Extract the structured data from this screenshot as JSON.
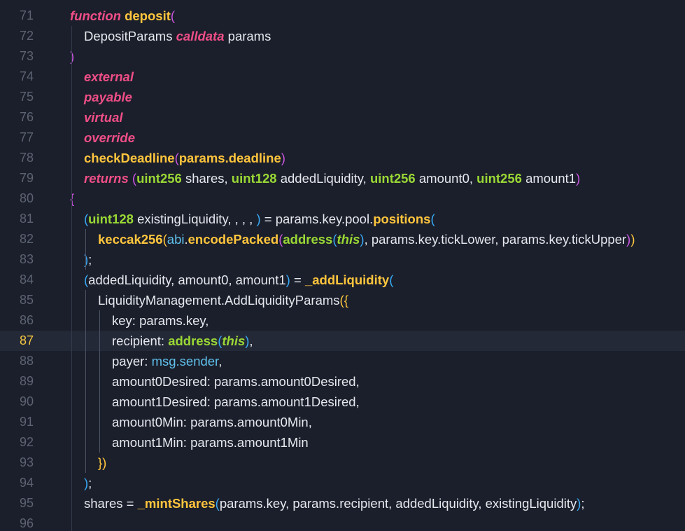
{
  "editor": {
    "current_line": 87,
    "colors": {
      "background": "#1b1f2b",
      "keyword": "#ef4e87",
      "type": "#9ad835",
      "function": "#ffc53d",
      "text": "#e6e8ee",
      "line_number": "#5d6372",
      "active_line_number": "#f3c63f",
      "builtin": "#5fc0ec"
    },
    "lines": [
      {
        "n": "71",
        "indent": 0,
        "tokens": [
          {
            "t": "kw",
            "v": "function"
          },
          {
            "t": "id",
            "v": " "
          },
          {
            "t": "fn",
            "v": "deposit"
          },
          {
            "t": "p1",
            "v": "("
          }
        ]
      },
      {
        "n": "72",
        "indent": 1,
        "tokens": [
          {
            "t": "id",
            "v": "DepositParams "
          },
          {
            "t": "kw",
            "v": "calldata"
          },
          {
            "t": "id",
            "v": " params"
          }
        ]
      },
      {
        "n": "73",
        "indent": 0,
        "tokens": [
          {
            "t": "p1",
            "v": ")"
          }
        ]
      },
      {
        "n": "74",
        "indent": 1,
        "tokens": [
          {
            "t": "kw",
            "v": "external"
          }
        ]
      },
      {
        "n": "75",
        "indent": 1,
        "tokens": [
          {
            "t": "kw",
            "v": "payable"
          }
        ]
      },
      {
        "n": "76",
        "indent": 1,
        "tokens": [
          {
            "t": "kw",
            "v": "virtual"
          }
        ]
      },
      {
        "n": "77",
        "indent": 1,
        "tokens": [
          {
            "t": "kw",
            "v": "override"
          }
        ]
      },
      {
        "n": "78",
        "indent": 1,
        "tokens": [
          {
            "t": "fn",
            "v": "checkDeadline"
          },
          {
            "t": "p1",
            "v": "("
          },
          {
            "t": "member",
            "v": "params.deadline"
          },
          {
            "t": "p1",
            "v": ")"
          }
        ]
      },
      {
        "n": "79",
        "indent": 1,
        "tokens": [
          {
            "t": "kw",
            "v": "returns"
          },
          {
            "t": "id",
            "v": " "
          },
          {
            "t": "p1",
            "v": "("
          },
          {
            "t": "type",
            "v": "uint256"
          },
          {
            "t": "id",
            "v": " shares, "
          },
          {
            "t": "type",
            "v": "uint128"
          },
          {
            "t": "id",
            "v": " addedLiquidity, "
          },
          {
            "t": "type",
            "v": "uint256"
          },
          {
            "t": "id",
            "v": " amount0, "
          },
          {
            "t": "type",
            "v": "uint256"
          },
          {
            "t": "id",
            "v": " amount1"
          },
          {
            "t": "p1",
            "v": ")"
          }
        ]
      },
      {
        "n": "80",
        "indent": 0,
        "tokens": [
          {
            "t": "p1",
            "v": "{"
          }
        ]
      },
      {
        "n": "81",
        "indent": 1,
        "tokens": [
          {
            "t": "p2",
            "v": "("
          },
          {
            "t": "type",
            "v": "uint128"
          },
          {
            "t": "id",
            "v": " existingLiquidity, , , , "
          },
          {
            "t": "p2",
            "v": ")"
          },
          {
            "t": "id",
            "v": " = params.key.pool."
          },
          {
            "t": "fn",
            "v": "positions"
          },
          {
            "t": "p2",
            "v": "("
          }
        ]
      },
      {
        "n": "82",
        "indent": 2,
        "tokens": [
          {
            "t": "fn",
            "v": "keccak256"
          },
          {
            "t": "p3",
            "v": "("
          },
          {
            "t": "builtin",
            "v": "abi"
          },
          {
            "t": "id",
            "v": "."
          },
          {
            "t": "fn",
            "v": "encodePacked"
          },
          {
            "t": "p1",
            "v": "("
          },
          {
            "t": "type",
            "v": "address"
          },
          {
            "t": "p2",
            "v": "("
          },
          {
            "t": "this",
            "v": "this"
          },
          {
            "t": "p2",
            "v": ")"
          },
          {
            "t": "id",
            "v": ", params.key.tickLower, params.key.tickUpper"
          },
          {
            "t": "p1",
            "v": ")"
          },
          {
            "t": "p3",
            "v": ")"
          }
        ]
      },
      {
        "n": "83",
        "indent": 1,
        "tokens": [
          {
            "t": "p2",
            "v": ")"
          },
          {
            "t": "id",
            "v": ";"
          }
        ]
      },
      {
        "n": "84",
        "indent": 1,
        "tokens": [
          {
            "t": "p2",
            "v": "("
          },
          {
            "t": "id",
            "v": "addedLiquidity, amount0, amount1"
          },
          {
            "t": "p2",
            "v": ")"
          },
          {
            "t": "id",
            "v": " = "
          },
          {
            "t": "fn",
            "v": "_addLiquidity"
          },
          {
            "t": "p2",
            "v": "("
          }
        ]
      },
      {
        "n": "85",
        "indent": 2,
        "tokens": [
          {
            "t": "id",
            "v": "LiquidityManagement.AddLiquidityParams"
          },
          {
            "t": "p3",
            "v": "({"
          }
        ]
      },
      {
        "n": "86",
        "indent": 3,
        "tokens": [
          {
            "t": "id",
            "v": "key: params.key,"
          }
        ]
      },
      {
        "n": "87",
        "indent": 3,
        "tokens": [
          {
            "t": "id",
            "v": "recipient: "
          },
          {
            "t": "type",
            "v": "address"
          },
          {
            "t": "p2",
            "v": "("
          },
          {
            "t": "this",
            "v": "this"
          },
          {
            "t": "p2",
            "v": ")"
          },
          {
            "t": "id",
            "v": ","
          }
        ]
      },
      {
        "n": "88",
        "indent": 3,
        "tokens": [
          {
            "t": "id",
            "v": "payer: "
          },
          {
            "t": "builtin",
            "v": "msg.sender"
          },
          {
            "t": "id",
            "v": ","
          }
        ]
      },
      {
        "n": "89",
        "indent": 3,
        "tokens": [
          {
            "t": "id",
            "v": "amount0Desired: params.amount0Desired,"
          }
        ]
      },
      {
        "n": "90",
        "indent": 3,
        "tokens": [
          {
            "t": "id",
            "v": "amount1Desired: params.amount1Desired,"
          }
        ]
      },
      {
        "n": "91",
        "indent": 3,
        "tokens": [
          {
            "t": "id",
            "v": "amount0Min: params.amount0Min,"
          }
        ]
      },
      {
        "n": "92",
        "indent": 3,
        "tokens": [
          {
            "t": "id",
            "v": "amount1Min: params.amount1Min"
          }
        ]
      },
      {
        "n": "93",
        "indent": 2,
        "tokens": [
          {
            "t": "p3",
            "v": "})"
          }
        ]
      },
      {
        "n": "94",
        "indent": 1,
        "tokens": [
          {
            "t": "p2",
            "v": ")"
          },
          {
            "t": "id",
            "v": ";"
          }
        ]
      },
      {
        "n": "95",
        "indent": 1,
        "tokens": [
          {
            "t": "id",
            "v": "shares = "
          },
          {
            "t": "fn",
            "v": "_mintShares"
          },
          {
            "t": "p2",
            "v": "("
          },
          {
            "t": "id",
            "v": "params.key, params.recipient, addedLiquidity, existingLiquidity"
          },
          {
            "t": "p2",
            "v": ")"
          },
          {
            "t": "id",
            "v": ";"
          }
        ]
      },
      {
        "n": "96",
        "indent": 0,
        "tokens": []
      }
    ]
  }
}
